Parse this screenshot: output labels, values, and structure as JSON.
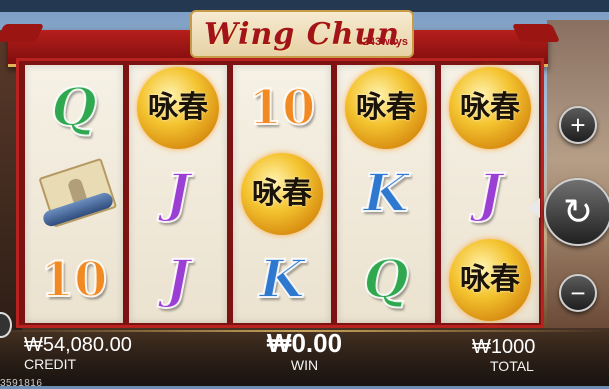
{
  "game": {
    "title": "Wing Chun",
    "ways": "243ways"
  },
  "reels": [
    [
      {
        "type": "letter",
        "value": "Q",
        "icon": "q-symbol-icon"
      },
      {
        "type": "scroll",
        "value": "",
        "icon": "scroll-book-icon"
      },
      {
        "type": "letter",
        "value": "10",
        "icon": "ten-symbol-icon"
      }
    ],
    [
      {
        "type": "coin",
        "value": "咏春",
        "icon": "wing-chun-coin-icon"
      },
      {
        "type": "letter",
        "value": "J",
        "icon": "j-symbol-icon"
      },
      {
        "type": "letter",
        "value": "J",
        "icon": "j-symbol-icon"
      }
    ],
    [
      {
        "type": "letter",
        "value": "10",
        "icon": "ten-symbol-icon"
      },
      {
        "type": "coin",
        "value": "咏春",
        "icon": "wing-chun-coin-icon"
      },
      {
        "type": "letter",
        "value": "K",
        "icon": "k-symbol-icon"
      }
    ],
    [
      {
        "type": "coin",
        "value": "咏春",
        "icon": "wing-chun-coin-icon"
      },
      {
        "type": "letter",
        "value": "K",
        "icon": "k-symbol-icon"
      },
      {
        "type": "letter",
        "value": "Q",
        "icon": "q-symbol-icon"
      }
    ],
    [
      {
        "type": "coin",
        "value": "咏春",
        "icon": "wing-chun-coin-icon"
      },
      {
        "type": "letter",
        "value": "J",
        "icon": "j-symbol-icon"
      },
      {
        "type": "coin",
        "value": "咏春",
        "icon": "wing-chun-coin-icon"
      }
    ]
  ],
  "controls": {
    "plus_symbol": "+",
    "minus_symbol": "−",
    "spin_symbol": "↻",
    "plus_icon": "plus-icon",
    "minus_icon": "minus-icon",
    "spin_icon": "spin-icon"
  },
  "status": {
    "credit_value": "₩54,080.00",
    "credit_label": "CREDIT",
    "win_value": "₩0.00",
    "win_label": "WIN",
    "total_value": "₩1000",
    "total_label": "TOTAL",
    "round_id": "3591816"
  },
  "colors": {
    "frame_red": "#b61f1c",
    "gold": "#f4c430",
    "q_green": "#2fa84f",
    "j_purple": "#9b3fd4",
    "k_blue": "#2e78d0",
    "ten_orange": "#f18a22"
  }
}
